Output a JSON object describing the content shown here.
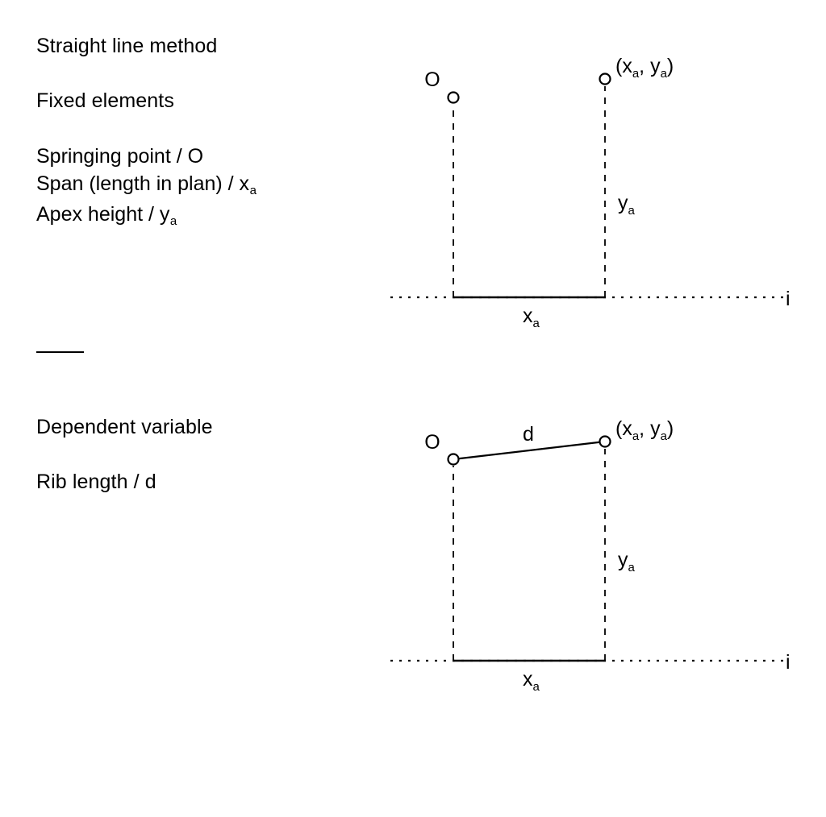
{
  "figure": {
    "title": "Straight line method",
    "sections": [
      {
        "heading": "Fixed elements",
        "items": [
          "Springing point / O",
          "Span (length in plan) / x",
          "Apex height / y"
        ]
      },
      {
        "heading": "Dependent variable",
        "items": [
          "Rib length / d"
        ]
      }
    ]
  },
  "text_column": {
    "title": "Straight line method",
    "fixed_elements_heading": "Fixed elements",
    "fixed_line_1_main": "Springing point / O",
    "fixed_line_2_main": "Span (length in plan) / x",
    "fixed_line_2_sub": "a",
    "fixed_line_3_main": "Apex height / y",
    "fixed_line_3_sub": "a",
    "dependent_heading": "Dependent variable",
    "dependent_line_1": "Rib length / d"
  },
  "diagram_top": {
    "name": "fixed-elements-diagram",
    "origin_label": "O",
    "apex_label_open": "(x",
    "apex_label_sub1": "a",
    "apex_label_mid": ", y",
    "apex_label_sub2": "a",
    "apex_label_close": ")",
    "height_label": "y",
    "height_label_sub": "a",
    "span_label": "x",
    "span_label_sub": "a",
    "baseline_label": "i"
  },
  "diagram_bottom": {
    "name": "dependent-variable-diagram",
    "origin_label": "O",
    "rib_label": "d",
    "apex_label_open": "(x",
    "apex_label_sub1": "a",
    "apex_label_mid": ", y",
    "apex_label_sub2": "a",
    "apex_label_close": ")",
    "height_label": "y",
    "height_label_sub": "a",
    "span_label": "x",
    "span_label_sub": "a",
    "baseline_label": "i"
  },
  "chart_data": {
    "type": "line",
    "title": "Straight line method",
    "xlabel": "",
    "ylabel": "",
    "panels": [
      {
        "name": "Fixed elements",
        "points": [
          {
            "label": "O",
            "x": 0,
            "y": 1.0,
            "note": "springing point"
          },
          {
            "label": "(x_a, y_a)",
            "x": 1.0,
            "y": 1.12,
            "note": "apex"
          }
        ],
        "segments": [
          {
            "name": "span",
            "from": [
              0,
              0
            ],
            "to": [
              1.0,
              0
            ],
            "style": "solid",
            "label": "x_a"
          },
          {
            "name": "springing-vertical",
            "from": [
              0,
              0
            ],
            "to": [
              0,
              1.0
            ],
            "style": "dashed"
          },
          {
            "name": "apex-vertical",
            "from": [
              1.0,
              0
            ],
            "to": [
              1.0,
              1.12
            ],
            "style": "dashed",
            "label": "y_a"
          },
          {
            "name": "ground-line",
            "from": [
              -0.42,
              0
            ],
            "to": [
              2.2,
              0
            ],
            "style": "dotted",
            "label": "i"
          }
        ],
        "rib_shown": false
      },
      {
        "name": "Dependent variable",
        "points": [
          {
            "label": "O",
            "x": 0,
            "y": 1.0,
            "note": "springing point"
          },
          {
            "label": "(x_a, y_a)",
            "x": 1.0,
            "y": 1.12,
            "note": "apex"
          }
        ],
        "segments": [
          {
            "name": "rib",
            "from": [
              0,
              1.0
            ],
            "to": [
              1.0,
              1.12
            ],
            "style": "solid",
            "label": "d"
          },
          {
            "name": "span",
            "from": [
              0,
              0
            ],
            "to": [
              1.0,
              0
            ],
            "style": "solid",
            "label": "x_a"
          },
          {
            "name": "springing-vertical",
            "from": [
              0,
              0
            ],
            "to": [
              0,
              1.0
            ],
            "style": "dashed"
          },
          {
            "name": "apex-vertical",
            "from": [
              1.0,
              0
            ],
            "to": [
              1.0,
              1.12
            ],
            "style": "dashed",
            "label": "y_a"
          },
          {
            "name": "ground-line",
            "from": [
              -0.42,
              0
            ],
            "to": [
              2.2,
              0
            ],
            "style": "dotted",
            "label": "i"
          }
        ],
        "rib_shown": true
      }
    ]
  }
}
